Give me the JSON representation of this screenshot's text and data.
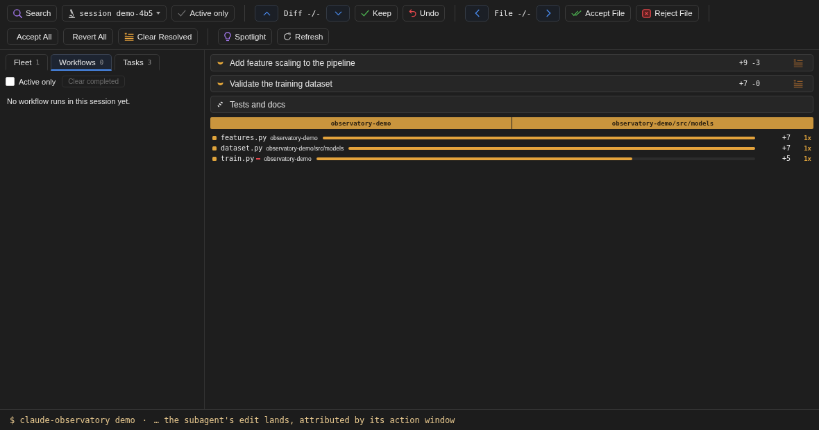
{
  "toolbar": {
    "groups": [
      {
        "items": [
          {
            "kind": "search",
            "label": "Search"
          },
          {
            "kind": "session",
            "label": "session demo-4b5"
          },
          {
            "kind": "filter",
            "label": "Active only",
            "on": false
          }
        ]
      },
      {
        "items": [
          {
            "kind": "up"
          },
          {
            "kind": "counter",
            "text": "Diff -/-"
          },
          {
            "kind": "down"
          },
          {
            "kind": "keep",
            "label": "Keep"
          },
          {
            "kind": "undo",
            "label": "Undo"
          }
        ]
      },
      {
        "items": [
          {
            "kind": "left"
          },
          {
            "kind": "counter",
            "text": "File -/-"
          },
          {
            "kind": "right"
          },
          {
            "kind": "accept",
            "label": "Accept File"
          },
          {
            "kind": "reject",
            "label": "Reject File"
          }
        ]
      },
      {
        "items": [
          {
            "kind": "accept-all",
            "label": "Accept All"
          },
          {
            "kind": "revert-all",
            "label": "Revert All"
          },
          {
            "kind": "clear",
            "label": "Clear Resolved"
          }
        ]
      },
      {
        "items": [
          {
            "kind": "spotlight",
            "label": "Spotlight"
          },
          {
            "kind": "refresh",
            "label": "Refresh"
          }
        ]
      }
    ]
  },
  "sidebar": {
    "tabs": [
      {
        "label": "Fleet",
        "count": "1",
        "selected": false
      },
      {
        "label": "Workflows",
        "count": "0",
        "selected": true
      },
      {
        "label": "Tasks",
        "count": "3",
        "selected": false
      }
    ],
    "filter": {
      "label": "Active only",
      "checked": false
    },
    "clear_button": {
      "label": "Clear completed",
      "disabled": true
    },
    "empty_message": "No workflow runs in this session yet."
  },
  "main": {
    "entries": [
      {
        "kind": "waiting",
        "title": "Add feature scaling to the pipeline",
        "stats": "+9 -3",
        "clearable": true
      },
      {
        "kind": "waiting",
        "title": "Validate the training dataset",
        "stats": "+7 -0",
        "clearable": true
      },
      {
        "kind": "running",
        "title": "Tests and docs",
        "clearable": false
      }
    ],
    "path_segments": [
      "observatory-demo",
      "observatory-demo/src/models"
    ],
    "files": [
      {
        "name": "features.py",
        "flagged": false,
        "dir": "observatory-demo",
        "level": 1,
        "count": "+7",
        "multiplier": "1x"
      },
      {
        "name": "dataset.py",
        "flagged": false,
        "dir": "observatory-demo/src/models",
        "level": 1,
        "count": "+7",
        "multiplier": "1x"
      },
      {
        "name": "train.py",
        "flagged": true,
        "dir": "observatory-demo",
        "level": 0.72,
        "count": "+5",
        "multiplier": "1x"
      }
    ]
  },
  "status_bar": {
    "command": "$ claude-observatory demo",
    "separator": "·",
    "message": "… the subagent's edit lands, attributed by its action window"
  }
}
